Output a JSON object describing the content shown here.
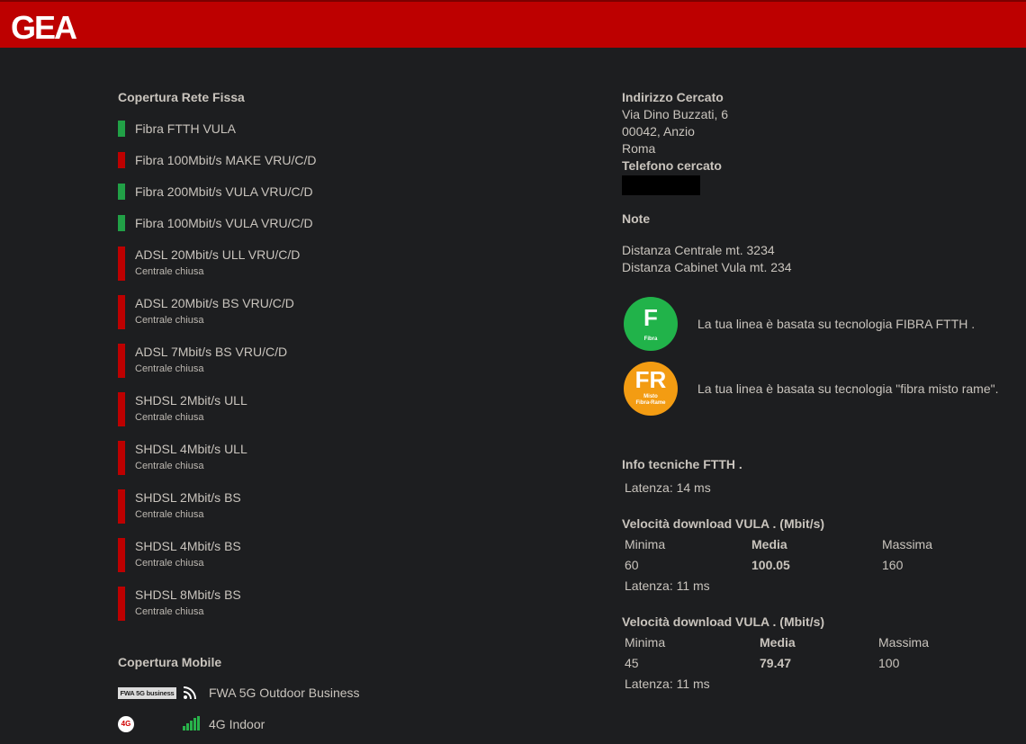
{
  "brand": {
    "logo_text": "GEA",
    "bar_color": "#bd0000"
  },
  "fixed": {
    "title": "Copertura Rete Fissa",
    "items": [
      {
        "label": "Fibra FTTH VULA",
        "status": "available",
        "sub": ""
      },
      {
        "label": "Fibra 100Mbit/s MAKE VRU/C/D",
        "status": "unavailable",
        "sub": ""
      },
      {
        "label": "Fibra 200Mbit/s VULA VRU/C/D",
        "status": "available",
        "sub": ""
      },
      {
        "label": "Fibra 100Mbit/s VULA VRU/C/D",
        "status": "available",
        "sub": ""
      },
      {
        "label": "ADSL 20Mbit/s ULL VRU/C/D",
        "status": "unavailable",
        "sub": "Centrale chiusa"
      },
      {
        "label": "ADSL 20Mbit/s BS VRU/C/D",
        "status": "unavailable",
        "sub": "Centrale chiusa"
      },
      {
        "label": "ADSL 7Mbit/s BS VRU/C/D",
        "status": "unavailable",
        "sub": "Centrale chiusa"
      },
      {
        "label": "SHDSL 2Mbit/s ULL",
        "status": "unavailable",
        "sub": "Centrale chiusa"
      },
      {
        "label": "SHDSL 4Mbit/s ULL",
        "status": "unavailable",
        "sub": "Centrale chiusa"
      },
      {
        "label": "SHDSL 2Mbit/s BS",
        "status": "unavailable",
        "sub": "Centrale chiusa"
      },
      {
        "label": "SHDSL 4Mbit/s BS",
        "status": "unavailable",
        "sub": "Centrale chiusa"
      },
      {
        "label": "SHDSL 8Mbit/s BS",
        "status": "unavailable",
        "sub": "Centrale chiusa"
      }
    ]
  },
  "mobile": {
    "title": "Copertura Mobile",
    "items": [
      {
        "badge": "FWA 5G business",
        "icon": "wifi-signal-icon",
        "label": "FWA 5G Outdoor Business"
      },
      {
        "badge": "4G",
        "icon": "signal-bars-icon",
        "label": "4G Indoor"
      }
    ]
  },
  "address": {
    "title": "Indirizzo Cercato",
    "line1": "Via Dino Buzzati, 6",
    "line2": "00042, Anzio",
    "line3": "Roma",
    "phone_title": "Telefono cercato"
  },
  "notes": {
    "title": "Note",
    "line1": "Distanza Centrale mt. 3234",
    "line2": "Distanza Cabinet Vula mt. 234"
  },
  "technologies": [
    {
      "code": "F",
      "caption": "Fibra",
      "color": "#21b34a",
      "text": "La tua linea è basata su tecnologia FIBRA FTTH ."
    },
    {
      "code": "FR",
      "caption1": "Misto",
      "caption2": "Fibra-Rame",
      "color": "#f39c12",
      "text": "La tua linea è basata su tecnologia \"fibra misto rame\"."
    }
  ],
  "ftth": {
    "title": "Info tecniche FTTH .",
    "latency": "Latenza: 14 ms"
  },
  "speed_blocks": [
    {
      "title": "Velocità download VULA . (Mbit/s)",
      "min_label": "Minima",
      "avg_label": "Media",
      "max_label": "Massima",
      "min": "60",
      "avg": "100.05",
      "max": "160",
      "latency": "Latenza: 11 ms"
    },
    {
      "title": "Velocità download VULA . (Mbit/s)",
      "min_label": "Minima",
      "avg_label": "Media",
      "max_label": "Massima",
      "min": "45",
      "avg": "79.47",
      "max": "100",
      "latency": "Latenza: 11 ms"
    }
  ]
}
